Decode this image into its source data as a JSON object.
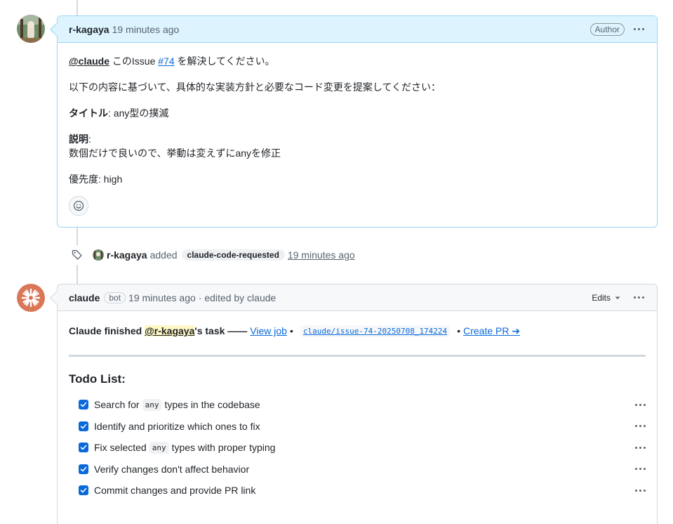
{
  "comment1": {
    "author": "r-kagaya",
    "time": "19 minutes ago",
    "badge": "Author",
    "mention": "@claude",
    "line1_mid": " このIssue ",
    "issue_link": "#74",
    "line1_end": " を解決してください。",
    "line2": "以下の内容に基づいて、具体的な実装方針と必要なコード変更を提案してください：",
    "title_label": "タイトル",
    "title_value": ": any型の撲滅",
    "desc_label": "説明",
    "desc_colon": ":",
    "desc_value": "数個だけで良いので、挙動は変えずにanyを修正",
    "priority": "優先度: high"
  },
  "event": {
    "actor": "r-kagaya",
    "action": "added",
    "label": "claude-code-requested",
    "time": "19 minutes ago"
  },
  "comment2": {
    "author": "claude",
    "bot_badge": "bot",
    "time": "19 minutes ago",
    "edited": "· edited by claude",
    "edits_label": "Edits",
    "task_prefix": "Claude finished ",
    "task_mention": "@r-kagaya",
    "task_suffix": "'s task ——",
    "view_job": "View job",
    "dot": "•",
    "branch": "claude/issue-74-20250708_174224",
    "create_pr": "Create PR ➔",
    "todo_title": "Todo List:",
    "todos": [
      {
        "before": "Search for",
        "code": "any",
        "after": "types in the codebase",
        "checked": true
      },
      {
        "before": "Identify and prioritize which ones to fix",
        "code": "",
        "after": "",
        "checked": true
      },
      {
        "before": "Fix selected",
        "code": "any",
        "after": "types with proper typing",
        "checked": true
      },
      {
        "before": "Verify changes don't affect behavior",
        "code": "",
        "after": "",
        "checked": true
      },
      {
        "before": "Commit changes and provide PR link",
        "code": "",
        "after": "",
        "checked": true
      }
    ]
  },
  "icons": {
    "kebab": "kebab-horizontal-icon",
    "tag": "tag-icon",
    "smiley": "smiley-icon",
    "check": "check-icon",
    "caret": "triangle-down-icon"
  },
  "colors": {
    "link": "#0969da",
    "author_header": "#ddf4ff",
    "claude_brand": "#d97757"
  }
}
